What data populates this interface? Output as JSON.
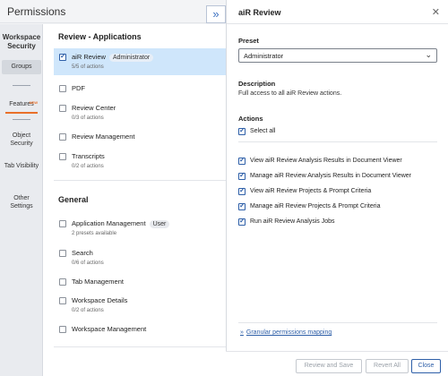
{
  "title": "Permissions",
  "expand_icon": "double-chevron-right-icon",
  "nav": {
    "header": "Workspace Security",
    "groups": "Groups",
    "features": "Features",
    "features_badge": "NEW",
    "object_security": "Object Security",
    "tab_visibility": "Tab Visibility",
    "other_settings": "Other Settings"
  },
  "sections": {
    "review_title": "Review - Applications",
    "general_title": "General"
  },
  "review_items": [
    {
      "label": "aiR Review",
      "pill": "Administrator",
      "sub": "5/5 of actions",
      "checked": true
    },
    {
      "label": "PDF",
      "pill": "",
      "sub": "",
      "checked": false
    },
    {
      "label": "Review Center",
      "pill": "",
      "sub": "0/3 of actions",
      "checked": false
    },
    {
      "label": "Review Management",
      "pill": "",
      "sub": "",
      "checked": false
    },
    {
      "label": "Transcripts",
      "pill": "",
      "sub": "0/2 of actions",
      "checked": false
    }
  ],
  "general_items": [
    {
      "label": "Application Management",
      "pill": "User",
      "sub": "2 presets available",
      "checked": false
    },
    {
      "label": "Search",
      "pill": "",
      "sub": "0/6 of actions",
      "checked": false
    },
    {
      "label": "Tab Management",
      "pill": "",
      "sub": "",
      "checked": false
    },
    {
      "label": "Workspace Details",
      "pill": "",
      "sub": "0/2 of actions",
      "checked": false
    },
    {
      "label": "Workspace Management",
      "pill": "",
      "sub": "",
      "checked": false
    }
  ],
  "panel": {
    "title": "aiR Review",
    "close_icon": "close-icon",
    "preset_label": "Preset",
    "preset_value": "Administrator",
    "description_label": "Description",
    "description_text": "Full access to all aiR Review actions.",
    "actions_label": "Actions",
    "select_all": "Select all",
    "actions": [
      "View aiR Review Analysis Results in Document Viewer",
      "Manage aiR Review Analysis Results in Document Viewer",
      "View aiR Review Projects & Prompt Criteria",
      "Manage aiR Review Projects & Prompt Criteria",
      "Run aiR Review Analysis Jobs"
    ],
    "mapping_link": "Granular permissions mapping"
  },
  "footer": {
    "review_save": "Review and Save",
    "revert_all": "Revert All",
    "close": "Close"
  }
}
